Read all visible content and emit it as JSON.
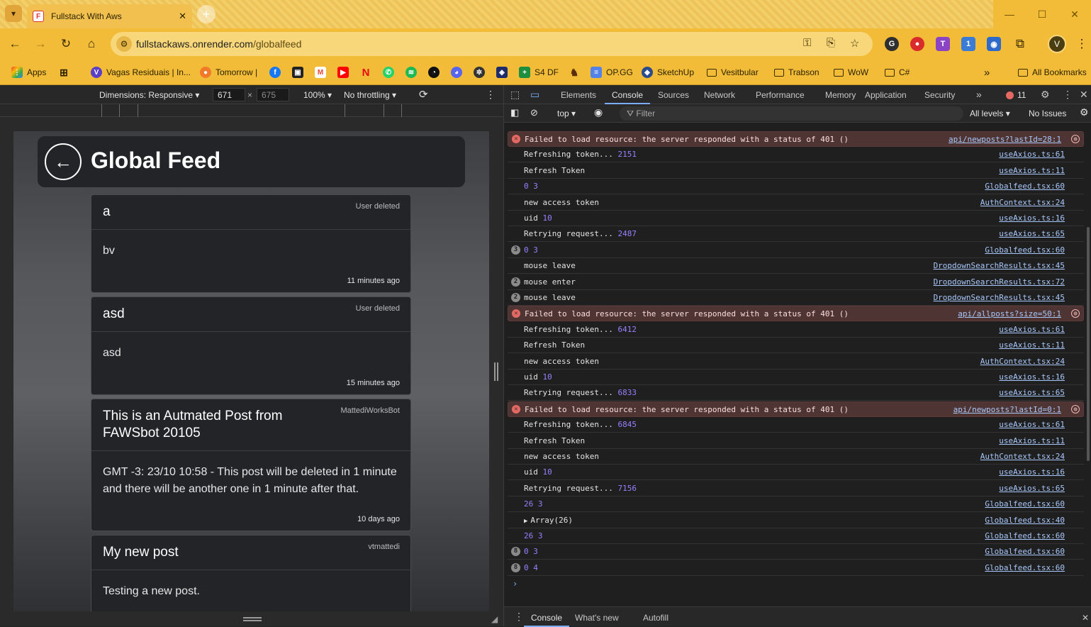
{
  "browser": {
    "tab_title": "Fullstack With Aws",
    "url_host": "fullstackaws.onrender.com",
    "url_path": "/globalfeed",
    "profile_initial": "V",
    "extension_badge": "1"
  },
  "bookmarks": [
    {
      "label": "Apps",
      "icon": "apps-grid-icon"
    },
    {
      "label": "",
      "icon": "grid-icon"
    },
    {
      "label": "Vagas Residuais | In...",
      "icon": "site-icon"
    },
    {
      "label": "Tomorrow |",
      "icon": "tomorrow-icon"
    },
    {
      "label": "S4 DF",
      "icon": "s4-icon"
    },
    {
      "label": "OP.GG",
      "icon": "opgg-icon"
    },
    {
      "label": "SketchUp",
      "icon": "sketchup-icon"
    },
    {
      "label": "Vesitbular",
      "icon": "folder-icon"
    },
    {
      "label": "Trabson",
      "icon": "folder-icon"
    },
    {
      "label": "WoW",
      "icon": "folder-icon"
    },
    {
      "label": "C#",
      "icon": "folder-icon"
    },
    {
      "label": "All Bookmarks",
      "icon": "folder-icon"
    }
  ],
  "device_toolbar": {
    "dimensions": "Dimensions: Responsive",
    "width": "671",
    "times": "×",
    "height": "675",
    "zoom": "100%",
    "throttling": "No throttling"
  },
  "feed": {
    "title": "Global Feed",
    "posts": [
      {
        "title": "a",
        "author": "User deleted",
        "content": "bv",
        "date": "11 minutes ago"
      },
      {
        "title": "asd",
        "author": "User deleted",
        "content": "asd",
        "date": "15 minutes ago"
      },
      {
        "title": "This is an Autmated Post from FAWSbot 20105",
        "author": "MattediWorksBot",
        "content": "GMT -3: 23/10 10:58 - This post will be deleted in 1 minute and there will be another one in 1 minute after that.",
        "date": "10 days ago"
      },
      {
        "title": "My new post",
        "author": "vtmattedi",
        "content": "Testing a new post.",
        "date": ""
      }
    ]
  },
  "devtools": {
    "tabs": [
      "Elements",
      "Console",
      "Sources",
      "Network",
      "Performance",
      "Memory",
      "Application",
      "Security"
    ],
    "active_tab": "Console",
    "error_count": "11",
    "context": "top",
    "filter_placeholder": "Filter",
    "levels": "All levels",
    "issues": "No Issues",
    "drawer_tabs": [
      "Console",
      "What's new",
      "Autofill"
    ],
    "log": [
      {
        "type": "err",
        "text": "Failed to load resource: the server responded with a status of 401 ()",
        "src": "api/newposts?lastId=28:1"
      },
      {
        "type": "log",
        "text": "Refreshing token...",
        "num": "2151",
        "src": "useAxios.ts:61"
      },
      {
        "type": "log",
        "text": "Refresh Token",
        "src": "useAxios.ts:11"
      },
      {
        "type": "log",
        "text": "",
        "num": "0 3",
        "src": "Globalfeed.tsx:60"
      },
      {
        "type": "log",
        "text": "new access token",
        "src": "AuthContext.tsx:24"
      },
      {
        "type": "log",
        "text": "uid",
        "num": "10",
        "src": "useAxios.ts:16"
      },
      {
        "type": "log",
        "text": "Retrying request...",
        "num": "2487",
        "src": "useAxios.ts:65"
      },
      {
        "type": "log",
        "badge": "3",
        "text": "",
        "num": "0 3",
        "src": "Globalfeed.tsx:60"
      },
      {
        "type": "log",
        "text": "mouse leave",
        "src": "DropdownSearchResults.tsx:45"
      },
      {
        "type": "log",
        "badge": "2",
        "text": "mouse enter",
        "src": "DropdownSearchResults.tsx:72"
      },
      {
        "type": "log",
        "badge": "2",
        "text": "mouse leave",
        "src": "DropdownSearchResults.tsx:45"
      },
      {
        "type": "err",
        "text": "Failed to load resource: the server responded with a status of 401 ()",
        "src": "api/allposts?size=50:1"
      },
      {
        "type": "log",
        "text": "Refreshing token...",
        "num": "6412",
        "src": "useAxios.ts:61"
      },
      {
        "type": "log",
        "text": "Refresh Token",
        "src": "useAxios.ts:11"
      },
      {
        "type": "log",
        "text": "new access token",
        "src": "AuthContext.tsx:24"
      },
      {
        "type": "log",
        "text": "uid",
        "num": "10",
        "src": "useAxios.ts:16"
      },
      {
        "type": "log",
        "text": "Retrying request...",
        "num": "6833",
        "src": "useAxios.ts:65"
      },
      {
        "type": "err",
        "text": "Failed to load resource: the server responded with a status of 401 ()",
        "src": "api/newposts?lastId=0:1"
      },
      {
        "type": "log",
        "text": "Refreshing token...",
        "num": "6845",
        "src": "useAxios.ts:61"
      },
      {
        "type": "log",
        "text": "Refresh Token",
        "src": "useAxios.ts:11"
      },
      {
        "type": "log",
        "text": "new access token",
        "src": "AuthContext.tsx:24"
      },
      {
        "type": "log",
        "text": "uid",
        "num": "10",
        "src": "useAxios.ts:16"
      },
      {
        "type": "log",
        "text": "Retrying request...",
        "num": "7156",
        "src": "useAxios.ts:65"
      },
      {
        "type": "log",
        "text": "",
        "num": "26 3",
        "src": "Globalfeed.tsx:60"
      },
      {
        "type": "log",
        "arrow": true,
        "text": "Array(26)",
        "src": "Globalfeed.tsx:40"
      },
      {
        "type": "log",
        "text": "",
        "num": "26 3",
        "src": "Globalfeed.tsx:60"
      },
      {
        "type": "log",
        "badge": "8",
        "text": "",
        "num": "0 3",
        "src": "Globalfeed.tsx:60"
      },
      {
        "type": "log",
        "badge": "8",
        "text": "",
        "num": "0 4",
        "src": "Globalfeed.tsx:60"
      }
    ]
  }
}
